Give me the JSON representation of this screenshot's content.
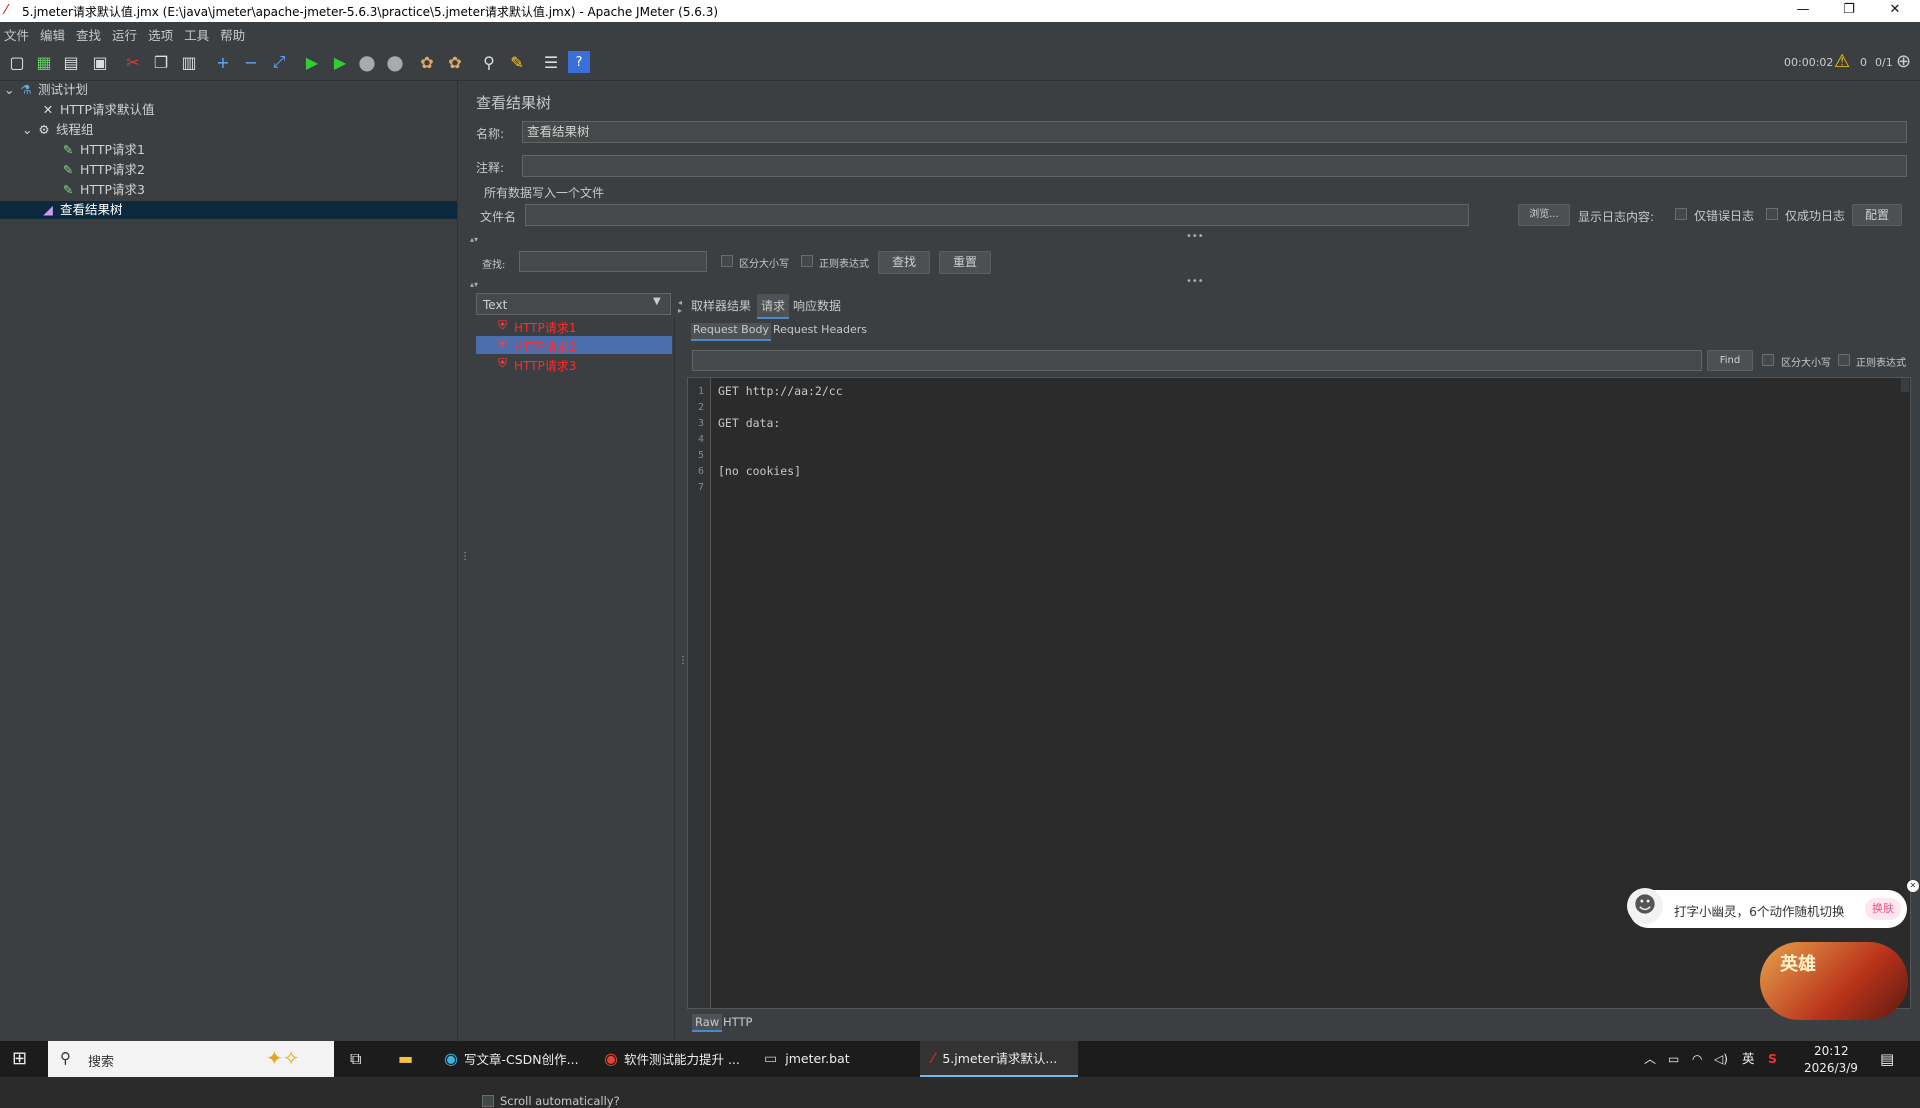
{
  "window": {
    "title": "5.jmeter请求默认值.jmx (E:\\java\\jmeter\\apache-jmeter-5.6.3\\practice\\5.jmeter请求默认值.jmx) - Apache JMeter (5.6.3)",
    "controls": [
      "minimize",
      "restore",
      "close"
    ]
  },
  "menu": [
    "文件",
    "编辑",
    "查找",
    "运行",
    "选项",
    "工具",
    "帮助"
  ],
  "toolbar": {
    "icons": [
      "new-icon",
      "templates-icon",
      "open-icon",
      "save-icon",
      "cut-icon",
      "copy-icon",
      "paste-icon",
      "expand-icon",
      "collapse-icon",
      "toggle-icon",
      "start-icon",
      "start-no-pause-icon",
      "stop-icon",
      "shutdown-icon",
      "clear-icon",
      "clear-all-icon",
      "search-icon",
      "reset-search-icon",
      "function-helper-icon",
      "help-icon"
    ],
    "timer": "00:00:02",
    "warnings": "0",
    "threads": "0/1"
  },
  "tree": {
    "items": [
      {
        "label": "测试计划",
        "icon": "test-plan-icon"
      },
      {
        "label": "HTTP请求默认值",
        "icon": "config-icon"
      },
      {
        "label": "线程组",
        "icon": "gear-icon"
      },
      {
        "label": "HTTP请求1",
        "icon": "sampler-icon"
      },
      {
        "label": "HTTP请求2",
        "icon": "sampler-icon"
      },
      {
        "label": "HTTP请求3",
        "icon": "sampler-icon"
      },
      {
        "label": "查看结果树",
        "icon": "listener-icon"
      }
    ]
  },
  "panel": {
    "heading": "查看结果树",
    "name_label": "名称:",
    "name_value": "查看结果树",
    "comment_label": "注释:",
    "comment_value": "",
    "file_section": "所有数据写入一个文件",
    "filename_label": "文件名",
    "browse_button": "浏览...",
    "log_label": "显示日志内容:",
    "errors_only": "仅错误日志",
    "success_only": "仅成功日志",
    "configure_button": "配置",
    "search_label": "查找:",
    "case_sensitive": "区分大小写",
    "regex": "正则表达式",
    "search_button": "查找",
    "reset_button": "重置"
  },
  "results": {
    "renderer": "Text",
    "samples": [
      "HTTP请求1",
      "HTTP请求2",
      "HTTP请求3"
    ],
    "selected_index": 1,
    "scroll_auto": "Scroll automatically?",
    "tabs": [
      "取样器结果",
      "请求",
      "响应数据"
    ],
    "active_tab": "请求",
    "subtabs": [
      "Request Body",
      "Request Headers"
    ],
    "find_button": "Find",
    "find_case": "区分大小写",
    "find_regex": "正则表达式",
    "bottom_tabs": [
      "Raw",
      "HTTP"
    ],
    "lines": [
      {
        "n": "1",
        "text": "GET http://aa:2/cc"
      },
      {
        "n": "2",
        "text": ""
      },
      {
        "n": "3",
        "text": "GET data:"
      },
      {
        "n": "4",
        "text": ""
      },
      {
        "n": "5",
        "text": ""
      },
      {
        "n": "6",
        "text": "[no cookies]"
      },
      {
        "n": "7",
        "text": ""
      }
    ]
  },
  "popup": {
    "text": "打字小幽灵，6个动作随机切换",
    "button": "换肤",
    "badge_text": "英雄"
  },
  "taskbar": {
    "search_placeholder": "搜索",
    "apps": [
      "写文章-CSDN创作...",
      "软件测试能力提升 ...",
      "jmeter.bat",
      "5.jmeter请求默认..."
    ],
    "ime": "英",
    "time": "20:12",
    "date": "2026/3/9"
  },
  "colors": {
    "background": "#3c3f41",
    "editor_bg": "#2b2b2b",
    "selection": "#0d293e",
    "list_selection": "#4b6eaf",
    "error_red": "#ff2a2a"
  }
}
